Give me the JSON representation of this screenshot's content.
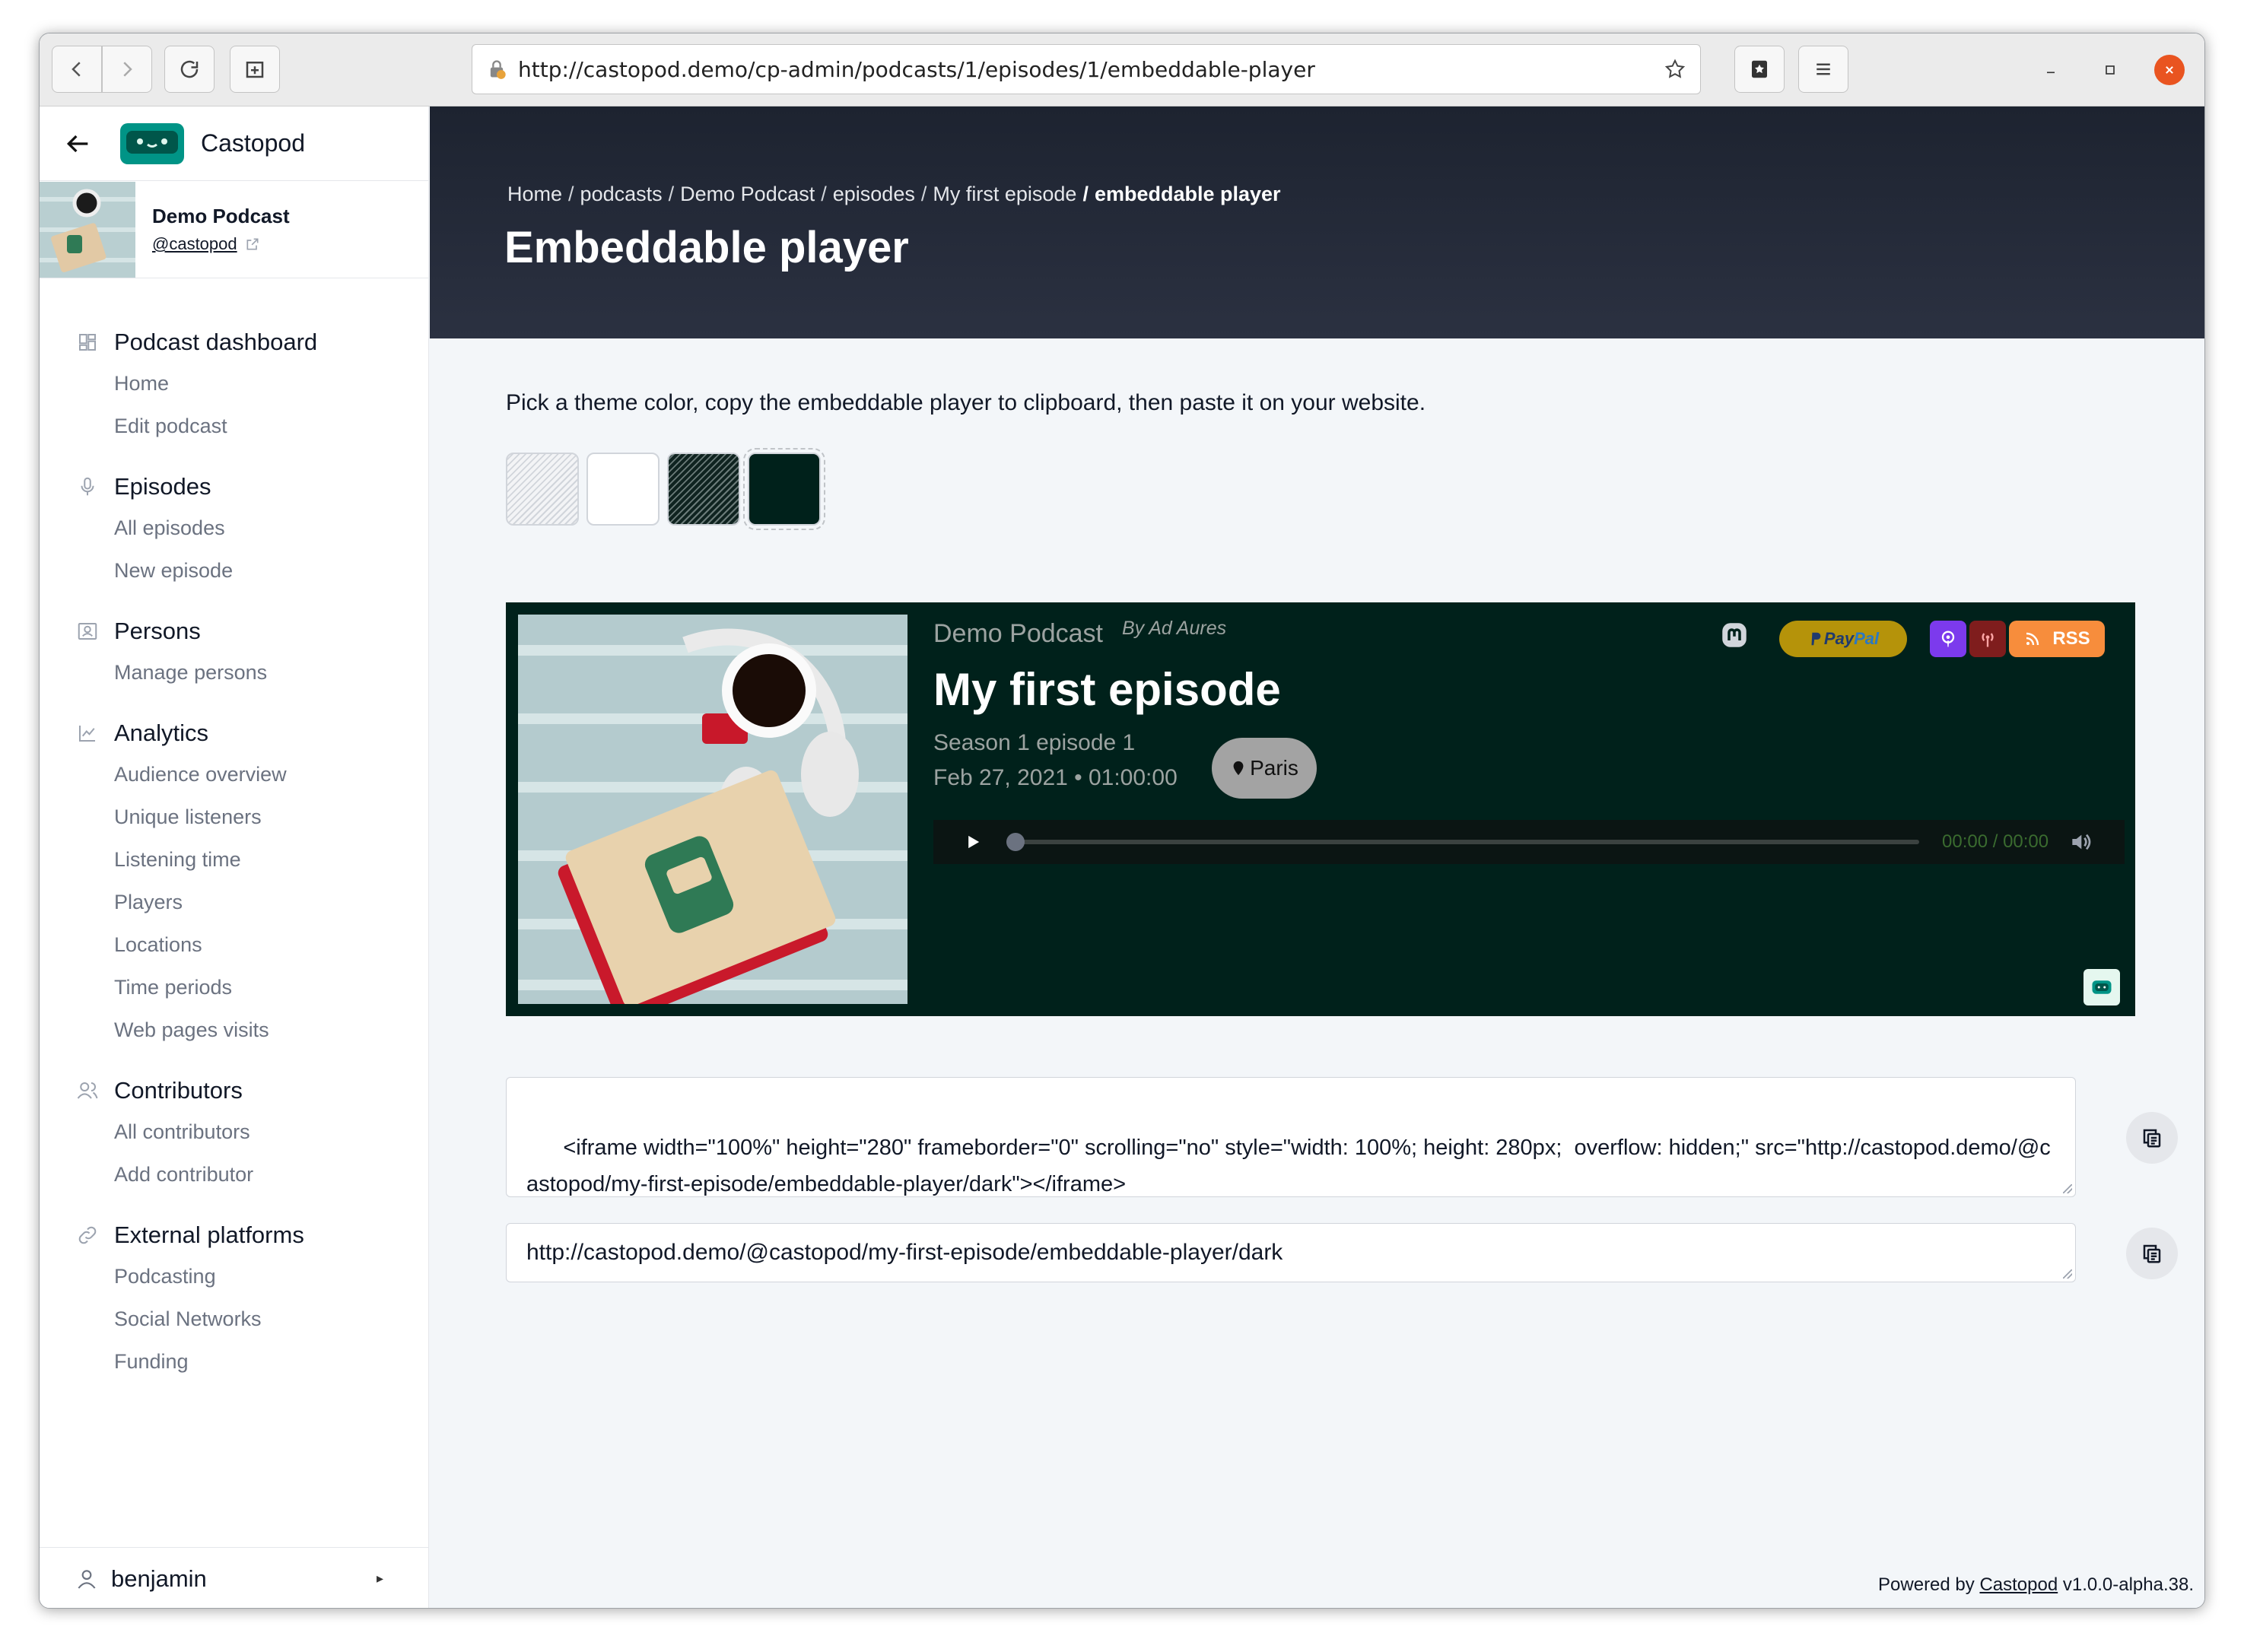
{
  "browser": {
    "url": "http://castopod.demo/cp-admin/podcasts/1/episodes/1/embeddable-player"
  },
  "sidebar": {
    "brand": "Castopod",
    "podcast": {
      "title": "Demo Podcast",
      "handle": "@castopod"
    },
    "groups": [
      {
        "title": "Podcast dashboard",
        "icon": "dashboard-icon",
        "items": [
          "Home",
          "Edit podcast"
        ]
      },
      {
        "title": "Episodes",
        "icon": "microphone-icon",
        "items": [
          "All episodes",
          "New episode"
        ]
      },
      {
        "title": "Persons",
        "icon": "persons-icon",
        "items": [
          "Manage persons"
        ]
      },
      {
        "title": "Analytics",
        "icon": "line-chart-icon",
        "items": [
          "Audience overview",
          "Unique listeners",
          "Listening time",
          "Players",
          "Locations",
          "Time periods",
          "Web pages visits"
        ]
      },
      {
        "title": "Contributors",
        "icon": "contributors-icon",
        "items": [
          "All contributors",
          "Add contributor"
        ]
      },
      {
        "title": "External platforms",
        "icon": "link-icon",
        "items": [
          "Podcasting",
          "Social Networks",
          "Funding"
        ]
      }
    ],
    "user": "benjamin",
    "user_caret": "▸"
  },
  "header": {
    "breadcrumb": [
      "Home",
      "podcasts",
      "Demo Podcast",
      "episodes",
      "My first episode"
    ],
    "breadcrumb_current": "embeddable player",
    "separator": "/",
    "title": "Embeddable player"
  },
  "main": {
    "instructions": "Pick a theme color, copy the embeddable player to clipboard, then paste it on your website.",
    "themes": [
      "light-transparent",
      "light",
      "dark-transparent",
      "dark"
    ],
    "selected_theme": "dark"
  },
  "player": {
    "podcast": "Demo Podcast",
    "author": "By Ad Aures",
    "title": "My first episode",
    "season": "Season 1 episode 1",
    "date": "Feb 27, 2021 • 01:00:00",
    "location": "Paris",
    "time": "00:00 / 00:00",
    "progress": 0,
    "paypal_a": "Pay",
    "paypal_b": "Pal",
    "rss": "RSS",
    "colors": {
      "background": "#00211b",
      "rss": "#f78d3c",
      "paypal": "#b5930a"
    }
  },
  "embed": {
    "iframe_code": "<iframe width=\"100%\" height=\"280\" frameborder=\"0\" scrolling=\"no\" style=\"width: 100%; height: 280px;  overflow: hidden;\" src=\"http://castopod.demo/@castopod/my-first-episode/embeddable-player/dark\"></iframe>",
    "url": "http://castopod.demo/@castopod/my-first-episode/embeddable-player/dark"
  },
  "footer": {
    "prefix": "Powered by",
    "link": "Castopod",
    "version": "v1.0.0-alpha.38."
  }
}
